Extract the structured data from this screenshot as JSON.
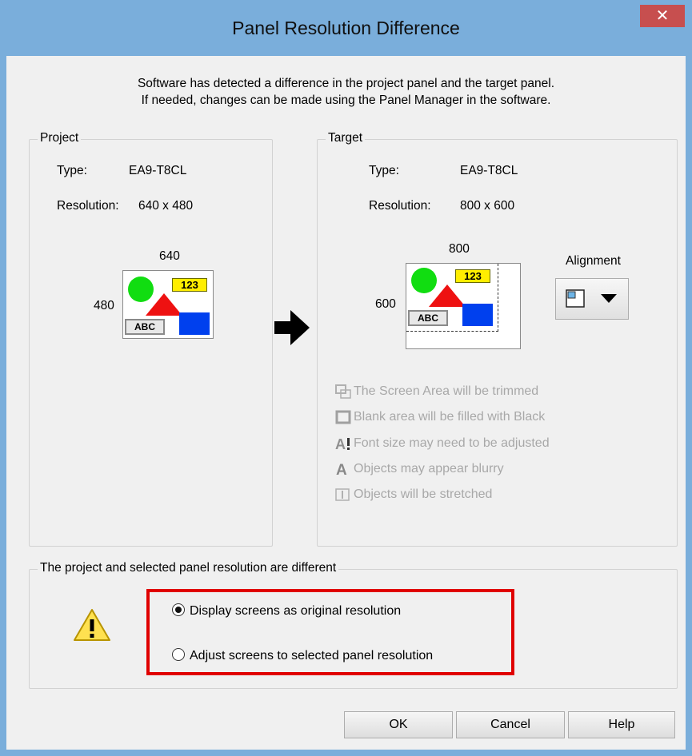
{
  "window": {
    "title": "Panel Resolution Difference",
    "close_glyph": "✕"
  },
  "intro": {
    "line1": "Software has detected a difference in the project panel and the target panel.",
    "line2": "If needed, changes can be made using the Panel Manager in the software."
  },
  "project": {
    "legend": "Project",
    "type_label": "Type:",
    "type_value": "EA9-T8CL",
    "res_label": "Resolution:",
    "res_value": "640 x 480",
    "width_label": "640",
    "height_label": "480",
    "tag_text": "123",
    "abc_text": "ABC"
  },
  "target": {
    "legend": "Target",
    "type_label": "Type:",
    "type_value": "EA9-T8CL",
    "res_label": "Resolution:",
    "res_value": "800 x 600",
    "width_label": "800",
    "height_label": "600",
    "tag_text": "123",
    "abc_text": "ABC",
    "alignment_label": "Alignment"
  },
  "notes": [
    {
      "icon": "trim-icon",
      "text": "The Screen Area will be trimmed"
    },
    {
      "icon": "blank-area-icon",
      "text": "Blank area will be filled with Black"
    },
    {
      "icon": "font-size-icon",
      "text": "Font size may need to be adjusted"
    },
    {
      "icon": "blurry-icon",
      "text": "Objects may appear blurry"
    },
    {
      "icon": "stretch-icon",
      "text": "Objects will be stretched"
    }
  ],
  "options": {
    "legend": "The project and selected panel resolution are different",
    "choices": [
      {
        "label": "Display screens as original resolution",
        "selected": true
      },
      {
        "label": "Adjust screens to selected panel resolution",
        "selected": false
      }
    ],
    "highlight_color": "#e00000"
  },
  "buttons": {
    "ok": "OK",
    "cancel": "Cancel",
    "help": "Help"
  },
  "colors": {
    "frame": "#7aaedb",
    "close": "#c74f4f",
    "client": "#f0f0f0"
  }
}
